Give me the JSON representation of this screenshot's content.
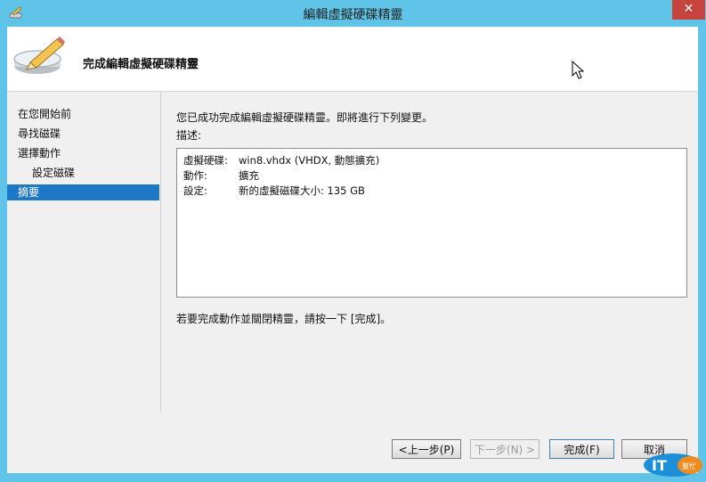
{
  "window": {
    "title": "編輯虛擬硬碟精靈",
    "close_glyph": "✕"
  },
  "banner": {
    "title": "完成編輯虛擬硬碟精靈"
  },
  "nav": {
    "items": [
      {
        "label": "在您開始前",
        "sub": false,
        "active": false
      },
      {
        "label": "尋找磁碟",
        "sub": false,
        "active": false
      },
      {
        "label": "選擇動作",
        "sub": false,
        "active": false
      },
      {
        "label": "設定磁碟",
        "sub": true,
        "active": false
      },
      {
        "label": "摘要",
        "sub": false,
        "active": true
      }
    ]
  },
  "content": {
    "intro": "您已成功完成編輯虛擬硬碟精靈。即將進行下列變更。",
    "desc_label": "描述:",
    "details": [
      {
        "key": "虛擬硬碟:",
        "value": "win8.vhdx (VHDX, 動態擴充)"
      },
      {
        "key": "動作:",
        "value": "擴充"
      },
      {
        "key": "設定:",
        "value": "新的虛擬磁碟大小: 135 GB"
      }
    ],
    "finish_text": "若要完成動作並關閉精靈，請按一下 [完成]。"
  },
  "buttons": {
    "previous": "<上一步(P)",
    "next": "下一步(N) >",
    "finish": "完成(F)",
    "cancel": "取消"
  },
  "watermark": {
    "logo_text": "IT",
    "logo_sub": "幫忙"
  },
  "colors": {
    "frame": "#5fc4e8",
    "accent": "#1e78c8",
    "close": "#c7443c"
  }
}
